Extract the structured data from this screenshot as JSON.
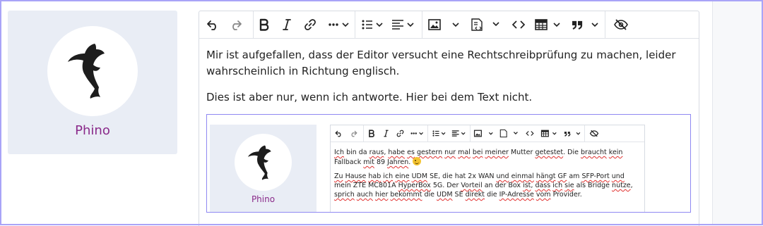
{
  "profile": {
    "name": "Phino",
    "avatar_icon": "dolphin-icon"
  },
  "editor": {
    "toolbar_icons": [
      "undo-icon",
      "redo-icon",
      "bold-icon",
      "italic-icon",
      "link-icon",
      "more-formatting-icon",
      "bullet-list-icon",
      "align-icon",
      "image-icon",
      "insert-template-icon",
      "code-icon",
      "table-icon",
      "blockquote-icon",
      "hide-icon"
    ],
    "paragraph_1": "Mir ist aufgefallen, dass der Editor versucht eine Rechtschreibprüfung zu machen, leider wahrscheinlich in Richtung englisch.",
    "paragraph_2": "Dies ist aber nur, wenn ich antworte. Hier bei dem Text nicht."
  },
  "quoted": {
    "profile_name": "Phino",
    "text": {
      "w_ich": "Ich",
      "t1": " bin da ",
      "w_raus": "raus",
      "t2": ", ",
      "w_habe": "habe",
      "t3": " ",
      "w_es": "es",
      "t4": " ",
      "w_gestern": "gestern",
      "t5": " ",
      "w_nur": "nur",
      "t6": " ",
      "w_mal": "mal",
      "t7": " ",
      "w_bei": "bei",
      "t8": " ",
      "w_meiner": "meiner",
      "t9": " Mutter ",
      "w_getestet": "getestet",
      "t10": ". Die ",
      "w_braucht": "braucht",
      "t11": " ",
      "w_kein": "kein",
      "t12": " Fallback ",
      "w_mit": "mit",
      "t13": " 89 ",
      "w_jahren": "Jahren",
      "t14": ".",
      "w_zu": "Zu",
      "t15": " ",
      "w_hause": "Hause",
      "t16": " ",
      "w_hab": "hab",
      "t17": " ",
      "w_ich2": "ich",
      "t18": " ",
      "w_eine": "eine",
      "t19": " ",
      "w_udm": "UDM",
      "t20": " SE, die hat 2x WAN ",
      "w_und": "und",
      "t21": " ",
      "w_einmal": "einmal",
      "t22": " ",
      "w_haengt": "hängt",
      "t23": " ",
      "w_gf": "GF",
      "t24": " am ",
      "w_sfp": "SFP-Port",
      "t25": " ",
      "w_und2": "und",
      "t26": " mein ZTE MC801A ",
      "w_hyperbox": "HyperBox",
      "t27": " 5G. Der ",
      "w_vorteil": "Vorteil",
      "t28": " an der Box ",
      "w_ist": "ist",
      "t29": ", ",
      "w_dass": "dass",
      "t30": " ",
      "w_ich3": "ich",
      "t31": " ",
      "w_sie": "sie",
      "t32": " als Bridge ",
      "w_nutze": "nutze",
      "t33": ", ",
      "w_sprich": "sprich",
      "t34": " ",
      "w_auch": "auch",
      "t35": " ",
      "w_hier": "hier",
      "t36": " ",
      "w_bekommt": "bekommt",
      "t37": " die ",
      "w_udm2": "UDM",
      "t38": " SE ",
      "w_direkt": "direkt",
      "t39": " die ",
      "w_ip": "IP-Adresse",
      "t40": " ",
      "w_vom": "vom",
      "t41": " Provider."
    }
  }
}
